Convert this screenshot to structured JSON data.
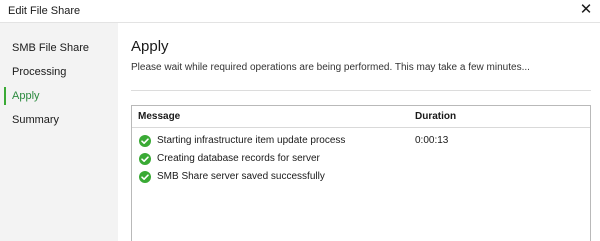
{
  "window": {
    "title": "Edit File Share",
    "close_glyph": "✕"
  },
  "sidebar": {
    "items": [
      {
        "label": "SMB File Share",
        "active": false
      },
      {
        "label": "Processing",
        "active": false
      },
      {
        "label": "Apply",
        "active": true
      },
      {
        "label": "Summary",
        "active": false
      }
    ]
  },
  "main": {
    "heading": "Apply",
    "description": "Please wait while required operations are being performed. This may take a few minutes...",
    "table": {
      "columns": [
        "Message",
        "Duration"
      ],
      "rows": [
        {
          "icon": "success-check-icon",
          "message": "Starting infrastructure item update process",
          "duration": "0:00:13"
        },
        {
          "icon": "success-check-icon",
          "message": "Creating database records for server",
          "duration": ""
        },
        {
          "icon": "success-check-icon",
          "message": "SMB Share server saved successfully",
          "duration": ""
        }
      ]
    }
  },
  "colors": {
    "success": "#3aaa35",
    "active_nav": "#2b8a3e",
    "sidebar_bg": "#f3f3f3"
  }
}
